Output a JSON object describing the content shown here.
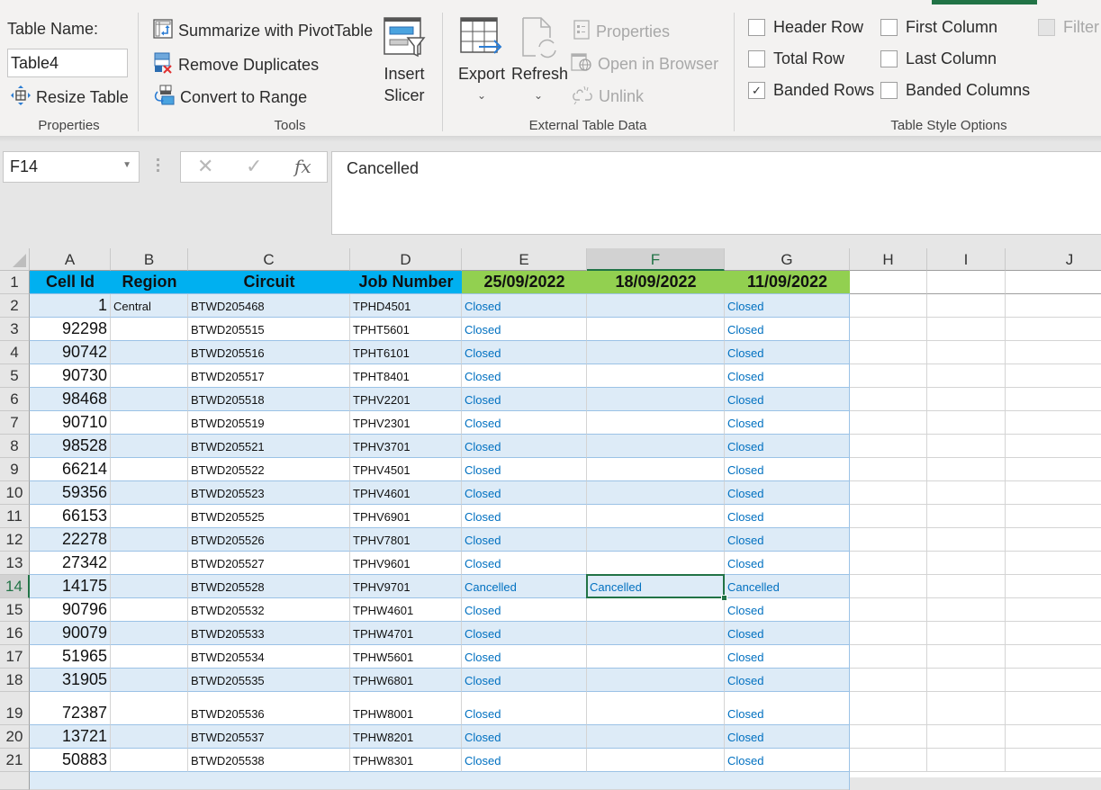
{
  "ribbon": {
    "active_tab_color": "#217346",
    "properties": {
      "group_label": "Properties",
      "table_name_label": "Table Name:",
      "table_name_value": "Table4",
      "resize_table": "Resize Table"
    },
    "tools": {
      "group_label": "Tools",
      "summarize_pivot": "Summarize with PivotTable",
      "remove_duplicates": "Remove Duplicates",
      "convert_to_range": "Convert to Range",
      "insert_slicer_line1": "Insert",
      "insert_slicer_line2": "Slicer"
    },
    "external": {
      "group_label": "External Table Data",
      "export": "Export",
      "refresh": "Refresh",
      "properties": "Properties",
      "open_in_browser": "Open in Browser",
      "unlink": "Unlink"
    },
    "style_options": {
      "group_label": "Table Style Options",
      "header_row": {
        "label": "Header Row",
        "checked": false
      },
      "total_row": {
        "label": "Total Row",
        "checked": false
      },
      "banded_rows": {
        "label": "Banded Rows",
        "checked": true
      },
      "first_column": {
        "label": "First Column",
        "checked": false
      },
      "last_column": {
        "label": "Last Column",
        "checked": false
      },
      "banded_columns": {
        "label": "Banded Columns",
        "checked": false
      },
      "filter_button": {
        "label": "Filter",
        "checked": false,
        "disabled": true
      }
    }
  },
  "formula_bar": {
    "name_box": "F14",
    "cancel_icon": "✕",
    "enter_icon": "✓",
    "fx_label": "fx",
    "value": "Cancelled"
  },
  "sheet": {
    "columns": [
      "A",
      "B",
      "C",
      "D",
      "E",
      "F",
      "G",
      "H",
      "I",
      "J"
    ],
    "selected_column": "F",
    "selected_row": 14,
    "header_colors": {
      "blue": "#00b0f0",
      "green": "#92d050",
      "band": "#ddebf7",
      "status_text": "#0070c0"
    },
    "table_headers": [
      "Cell Id",
      "Region",
      "Circuit",
      "Job Number",
      "25/09/2022",
      "18/09/2022",
      "11/09/2022"
    ],
    "rows": [
      {
        "row": 2,
        "cell_id": "1",
        "region": "Central",
        "circuit": "BTWD205468",
        "job": "TPHD4501",
        "e": "Closed",
        "f": "",
        "g": "Closed"
      },
      {
        "row": 3,
        "cell_id": "92298",
        "region": "",
        "circuit": "BTWD205515",
        "job": "TPHT5601",
        "e": "Closed",
        "f": "",
        "g": "Closed"
      },
      {
        "row": 4,
        "cell_id": "90742",
        "region": "",
        "circuit": "BTWD205516",
        "job": "TPHT6101",
        "e": "Closed",
        "f": "",
        "g": "Closed"
      },
      {
        "row": 5,
        "cell_id": "90730",
        "region": "",
        "circuit": "BTWD205517",
        "job": "TPHT8401",
        "e": "Closed",
        "f": "",
        "g": "Closed"
      },
      {
        "row": 6,
        "cell_id": "98468",
        "region": "",
        "circuit": "BTWD205518",
        "job": "TPHV2201",
        "e": "Closed",
        "f": "",
        "g": "Closed"
      },
      {
        "row": 7,
        "cell_id": "90710",
        "region": "",
        "circuit": "BTWD205519",
        "job": "TPHV2301",
        "e": "Closed",
        "f": "",
        "g": "Closed"
      },
      {
        "row": 8,
        "cell_id": "98528",
        "region": "",
        "circuit": "BTWD205521",
        "job": "TPHV3701",
        "e": "Closed",
        "f": "",
        "g": "Closed"
      },
      {
        "row": 9,
        "cell_id": "66214",
        "region": "",
        "circuit": "BTWD205522",
        "job": "TPHV4501",
        "e": "Closed",
        "f": "",
        "g": "Closed"
      },
      {
        "row": 10,
        "cell_id": "59356",
        "region": "",
        "circuit": "BTWD205523",
        "job": "TPHV4601",
        "e": "Closed",
        "f": "",
        "g": "Closed"
      },
      {
        "row": 11,
        "cell_id": "66153",
        "region": "",
        "circuit": "BTWD205525",
        "job": "TPHV6901",
        "e": "Closed",
        "f": "",
        "g": "Closed"
      },
      {
        "row": 12,
        "cell_id": "22278",
        "region": "",
        "circuit": "BTWD205526",
        "job": "TPHV7801",
        "e": "Closed",
        "f": "",
        "g": "Closed"
      },
      {
        "row": 13,
        "cell_id": "27342",
        "region": "",
        "circuit": "BTWD205527",
        "job": "TPHV9601",
        "e": "Closed",
        "f": "",
        "g": "Closed"
      },
      {
        "row": 14,
        "cell_id": "14175",
        "region": "",
        "circuit": "BTWD205528",
        "job": "TPHV9701",
        "e": "Cancelled",
        "f": "Cancelled",
        "g": "Cancelled"
      },
      {
        "row": 15,
        "cell_id": "90796",
        "region": "",
        "circuit": "BTWD205532",
        "job": "TPHW4601",
        "e": "Closed",
        "f": "",
        "g": "Closed"
      },
      {
        "row": 16,
        "cell_id": "90079",
        "region": "",
        "circuit": "BTWD205533",
        "job": "TPHW4701",
        "e": "Closed",
        "f": "",
        "g": "Closed"
      },
      {
        "row": 17,
        "cell_id": "51965",
        "region": "",
        "circuit": "BTWD205534",
        "job": "TPHW5601",
        "e": "Closed",
        "f": "",
        "g": "Closed"
      },
      {
        "row": 18,
        "cell_id": "31905",
        "region": "",
        "circuit": "BTWD205535",
        "job": "TPHW6801",
        "e": "Closed",
        "f": "",
        "g": "Closed"
      },
      {
        "row": 19,
        "cell_id": "72387",
        "region": "",
        "circuit": "BTWD205536",
        "job": "TPHW8001",
        "e": "Closed",
        "f": "",
        "g": "Closed"
      },
      {
        "row": 20,
        "cell_id": "13721",
        "region": "",
        "circuit": "BTWD205537",
        "job": "TPHW8201",
        "e": "Closed",
        "f": "",
        "g": "Closed"
      },
      {
        "row": 21,
        "cell_id": "50883",
        "region": "",
        "circuit": "BTWD205538",
        "job": "TPHW8301",
        "e": "Closed",
        "f": "",
        "g": "Closed"
      }
    ]
  }
}
